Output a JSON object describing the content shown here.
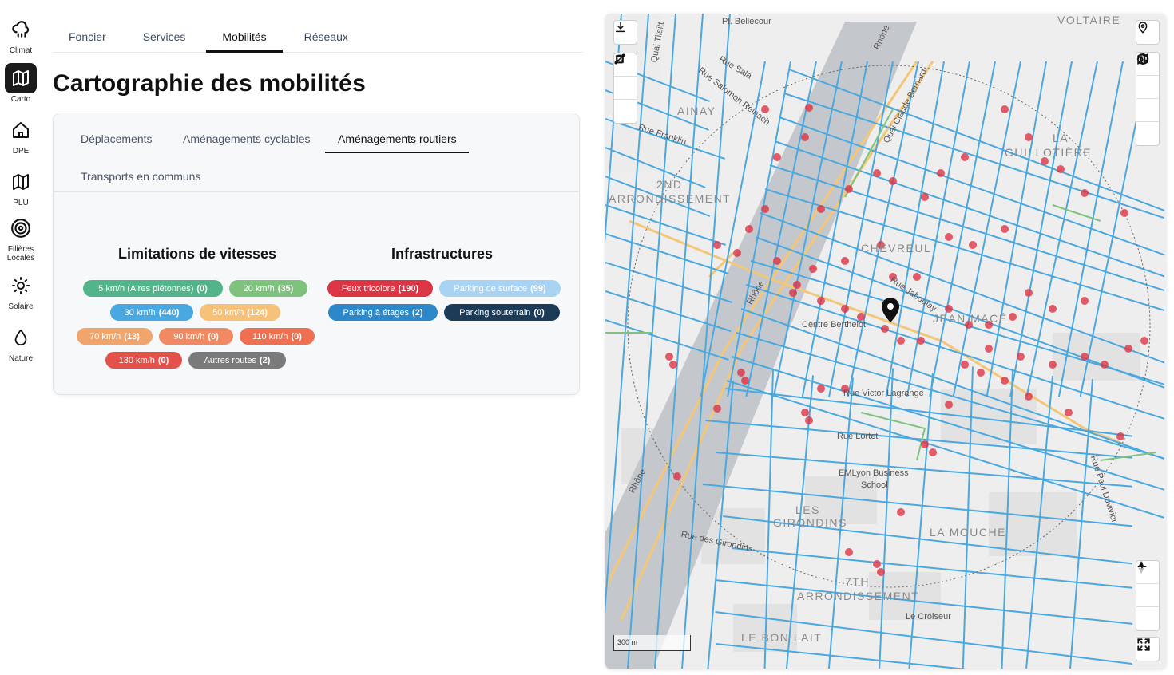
{
  "rail": [
    {
      "label": "Climat",
      "icon": "cloud-rain-icon"
    },
    {
      "label": "Carto",
      "icon": "map-icon"
    },
    {
      "label": "DPE",
      "icon": "home-icon"
    },
    {
      "label": "PLU",
      "icon": "map-outline-icon"
    },
    {
      "label": "Filières Locales",
      "icon": "target-icon"
    },
    {
      "label": "Solaire",
      "icon": "sun-icon"
    },
    {
      "label": "Nature",
      "icon": "drop-icon"
    }
  ],
  "tabs": [
    "Foncier",
    "Services",
    "Mobilités",
    "Réseaux"
  ],
  "active_tab": "Mobilités",
  "title": "Cartographie des mobilités",
  "subtabs": [
    "Déplacements",
    "Aménagements cyclables",
    "Aménagements routiers",
    "Transports en communs"
  ],
  "active_subtab": "Aménagements routiers",
  "speed_section": {
    "title": "Limitations de vitesses",
    "pills": [
      {
        "label": "5 km/h (Aires piétonnes)",
        "count": "(0)",
        "color": "#53b48c"
      },
      {
        "label": "20 km/h",
        "count": "(35)",
        "color": "#7fc27e"
      },
      {
        "label": "30 km/h",
        "count": "(440)",
        "color": "#4aa8e0"
      },
      {
        "label": "50 km/h",
        "count": "(124)",
        "color": "#f6c27a"
      },
      {
        "label": "70 km/h",
        "count": "(13)",
        "color": "#f2a56a"
      },
      {
        "label": "90 km/h",
        "count": "(0)",
        "color": "#f08a62"
      },
      {
        "label": "110 km/h",
        "count": "(0)",
        "color": "#ee7050"
      },
      {
        "label": "130 km/h",
        "count": "(0)",
        "color": "#e4504a"
      },
      {
        "label": "Autres routes",
        "count": "(2)",
        "color": "#7a7a7a"
      }
    ]
  },
  "infra_section": {
    "title": "Infrastructures",
    "pills": [
      {
        "label": "Feux tricolore",
        "count": "(190)",
        "color": "#dc3545"
      },
      {
        "label": "Parking de surface",
        "count": "(99)",
        "color": "#a9d3f2"
      },
      {
        "label": "Parking à étages",
        "count": "(2)",
        "color": "#2c88c8"
      },
      {
        "label": "Parking souterrain",
        "count": "(0)",
        "color": "#1c3b57"
      }
    ]
  },
  "map": {
    "scale_label": "300 m",
    "labels": [
      "Pl. Bellecour",
      "VOLTAIRE",
      "AINAY",
      "2ND",
      "ARRONDISSEMENT",
      "LA",
      "GUILLOTIÈRE",
      "CHEVREUL",
      "JEAN MACÉ",
      "Centre Berthelot",
      "Rue Victor Lagrange",
      "Rue Lortet",
      "EMLyon Business",
      "School",
      "LES",
      "GIRONDINS",
      "LA MOUCHE",
      "7TH",
      "ARRONDISSEMENT",
      "Le Croiseur",
      "LE BON LAIT",
      "Rhône",
      "Rhône",
      "Rhône",
      "Rue Franklin",
      "Rue Sala",
      "Quai Tilsitt",
      "Quai Claude Bernard",
      "Rue Jaboulay",
      "Rue des Girondins",
      "Rue Paul Duvivier",
      "Rue Salomon Reinach"
    ],
    "controls": [
      "download-icon",
      "draw-line-icon",
      "draw-polygon-icon",
      "trash-icon",
      "location-pin-icon",
      "sun-icon",
      "map-icon",
      "globe-icon",
      "circle-icon",
      "zoom-in-icon",
      "zoom-out-icon",
      "compass-icon",
      "fullscreen-icon"
    ]
  }
}
